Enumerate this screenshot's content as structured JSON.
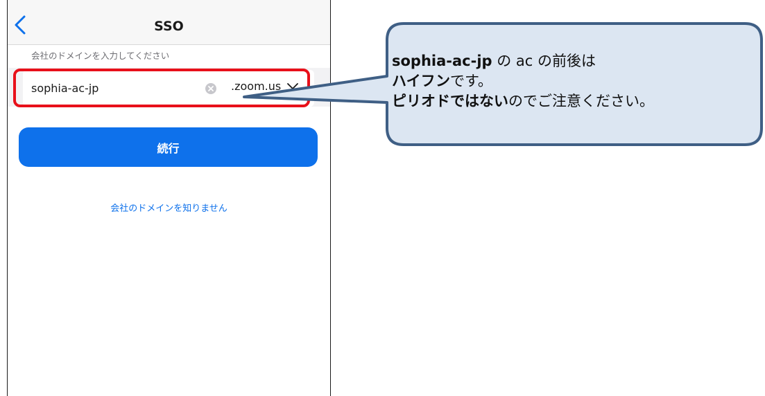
{
  "screen": {
    "title": "SSO",
    "back_icon": "chevron-left-icon",
    "prompt": "会社のドメインを入力してください",
    "domain_input": {
      "value": "sophia-ac-jp",
      "clear_icon": "clear-x-circle-icon"
    },
    "domain_suffix": {
      "selected": ".zoom.us",
      "icon": "chevron-down-icon"
    },
    "continue_label": "続行",
    "unknown_domain_link": "会社のドメインを知りません"
  },
  "callout": {
    "line1_bold": "sophia-ac-jp",
    "line1_rest": " の ac の前後は",
    "line2_bold": "ハイフン",
    "line2_rest": "です。",
    "line3_bold": "ピリオドではない",
    "line3_rest": "のでご注意ください。"
  },
  "colors": {
    "accent": "#0e71eb",
    "highlight": "#e8101a",
    "callout_fill": "#dce6f2",
    "callout_border": "#3f5f85"
  }
}
